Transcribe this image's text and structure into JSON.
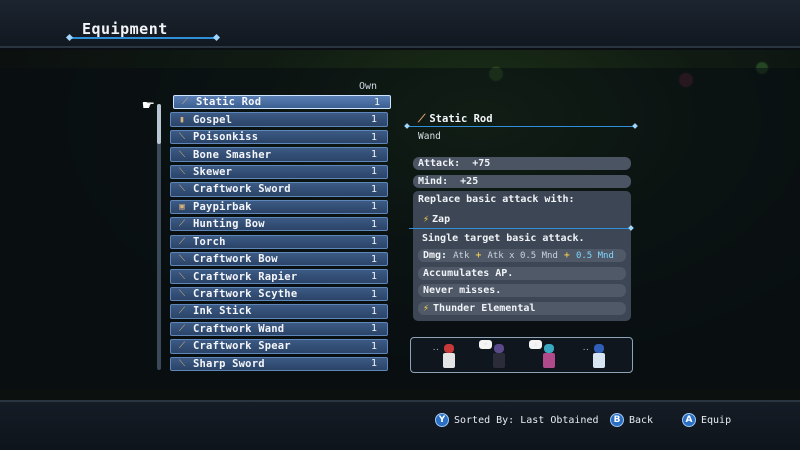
{
  "header": {
    "title": "Equipment"
  },
  "list": {
    "own_header": "Own",
    "items": [
      {
        "name": "Static Rod",
        "count": "1",
        "icon": "rod-icon",
        "glyph": "⟋",
        "selected": true
      },
      {
        "name": "Gospel",
        "count": "1",
        "icon": "book-icon",
        "glyph": "▮"
      },
      {
        "name": "Poisonkiss",
        "count": "1",
        "icon": "dagger-icon",
        "glyph": "⟍"
      },
      {
        "name": "Bone Smasher",
        "count": "1",
        "icon": "club-icon",
        "glyph": "⟍"
      },
      {
        "name": "Skewer",
        "count": "1",
        "icon": "spear-icon",
        "glyph": "⟍"
      },
      {
        "name": "Craftwork Sword",
        "count": "1",
        "icon": "sword-icon",
        "glyph": "⟍"
      },
      {
        "name": "Paypirbak",
        "count": "1",
        "icon": "book-icon",
        "glyph": "▣"
      },
      {
        "name": "Hunting Bow",
        "count": "1",
        "icon": "bow-icon",
        "glyph": "⟋"
      },
      {
        "name": "Torch",
        "count": "1",
        "icon": "torch-icon",
        "glyph": "⟋"
      },
      {
        "name": "Craftwork Bow",
        "count": "1",
        "icon": "bow-icon",
        "glyph": "⟍"
      },
      {
        "name": "Craftwork Rapier",
        "count": "1",
        "icon": "rapier-icon",
        "glyph": "⟍"
      },
      {
        "name": "Craftwork Scythe",
        "count": "1",
        "icon": "scythe-icon",
        "glyph": "⟍"
      },
      {
        "name": "Ink Stick",
        "count": "1",
        "icon": "wand-icon",
        "glyph": "⟋"
      },
      {
        "name": "Craftwork Wand",
        "count": "1",
        "icon": "wand-icon",
        "glyph": "⟋"
      },
      {
        "name": "Craftwork Spear",
        "count": "1",
        "icon": "spear-icon",
        "glyph": "⟋"
      },
      {
        "name": "Sharp Sword",
        "count": "1",
        "icon": "sword-icon",
        "glyph": "⟍"
      }
    ]
  },
  "detail": {
    "name": "Static Rod",
    "type": "Wand",
    "stats": {
      "attack_label": "Attack:",
      "attack_value": "+75",
      "mind_label": "Mind:",
      "mind_value": "+25"
    },
    "skill": {
      "header": "Replace basic attack with:",
      "name": "Zap",
      "description": "Single target basic attack.",
      "dmg_label": "Dmg:",
      "dmg_atk": "Atk",
      "dmg_atk_scaled": "Atk x 0.5 Mnd",
      "dmg_mnd": "0.5 Mnd",
      "ap": "Accumulates AP.",
      "miss": "Never misses.",
      "element": "Thunder Elemental"
    }
  },
  "party": {
    "members": [
      {
        "name": "hero-1",
        "head": "#c83a3a",
        "body": "#e4e4e4",
        "bubble": ""
      },
      {
        "name": "hero-2",
        "head": "#5a4a8c",
        "body": "#2b2b3a",
        "bubble": "❤"
      },
      {
        "name": "hero-3",
        "head": "#3aa8c0",
        "body": "#b04a8a",
        "bubble": "▲"
      },
      {
        "name": "hero-4",
        "head": "#2f5fb8",
        "body": "#d7e4f2",
        "bubble": ""
      }
    ]
  },
  "footer": {
    "sort": {
      "button": "Y",
      "label": "Sorted By: Last Obtained"
    },
    "back": {
      "button": "B",
      "label": "Back"
    },
    "equip": {
      "button": "A",
      "label": "Equip"
    }
  },
  "colors": {
    "accent_line": "#2f8fd8",
    "item_fill": "#2b4468",
    "selected_fill": "#3c5f90",
    "button_blue": "#2a6fc4"
  }
}
